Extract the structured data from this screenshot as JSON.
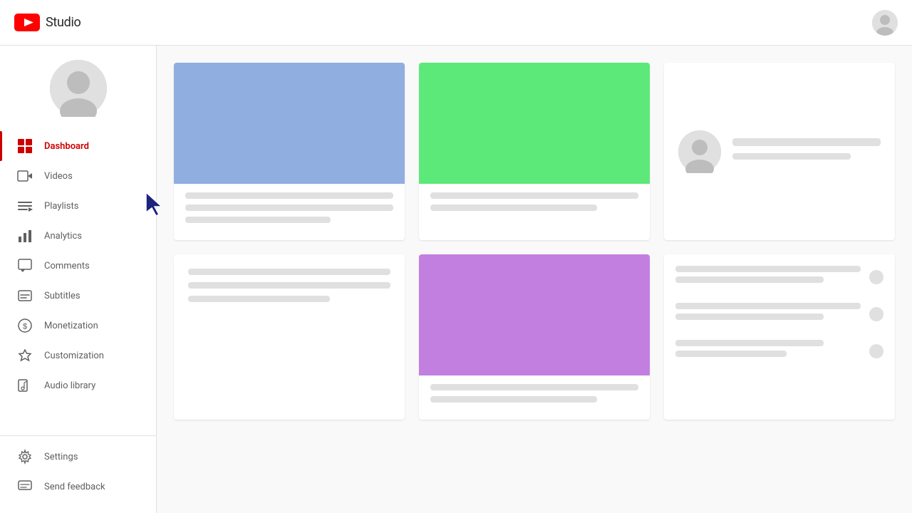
{
  "header": {
    "title": "Studio",
    "logo_alt": "YouTube Studio logo"
  },
  "sidebar": {
    "items": [
      {
        "id": "dashboard",
        "label": "Dashboard",
        "icon": "dashboard-icon",
        "active": true
      },
      {
        "id": "videos",
        "label": "Videos",
        "icon": "videos-icon",
        "active": false
      },
      {
        "id": "playlists",
        "label": "Playlists",
        "icon": "playlists-icon",
        "active": false
      },
      {
        "id": "analytics",
        "label": "Analytics",
        "icon": "analytics-icon",
        "active": false
      },
      {
        "id": "comments",
        "label": "Comments",
        "icon": "comments-icon",
        "active": false
      },
      {
        "id": "subtitles",
        "label": "Subtitles",
        "icon": "subtitles-icon",
        "active": false
      },
      {
        "id": "monetization",
        "label": "Monetization",
        "icon": "monetization-icon",
        "active": false
      },
      {
        "id": "customization",
        "label": "Customization",
        "icon": "customization-icon",
        "active": false
      },
      {
        "id": "audio-library",
        "label": "Audio library",
        "icon": "audio-icon",
        "active": false
      }
    ],
    "bottom_items": [
      {
        "id": "settings",
        "label": "Settings",
        "icon": "settings-icon"
      },
      {
        "id": "send-feedback",
        "label": "Send feedback",
        "icon": "feedback-icon"
      }
    ]
  },
  "main": {
    "cards": [
      {
        "id": "card-1",
        "thumb_color": "blue"
      },
      {
        "id": "card-2",
        "thumb_color": "green"
      },
      {
        "id": "card-3",
        "type": "profile"
      },
      {
        "id": "card-4",
        "type": "empty"
      },
      {
        "id": "card-5",
        "thumb_color": "purple"
      },
      {
        "id": "card-6",
        "type": "list"
      }
    ]
  }
}
